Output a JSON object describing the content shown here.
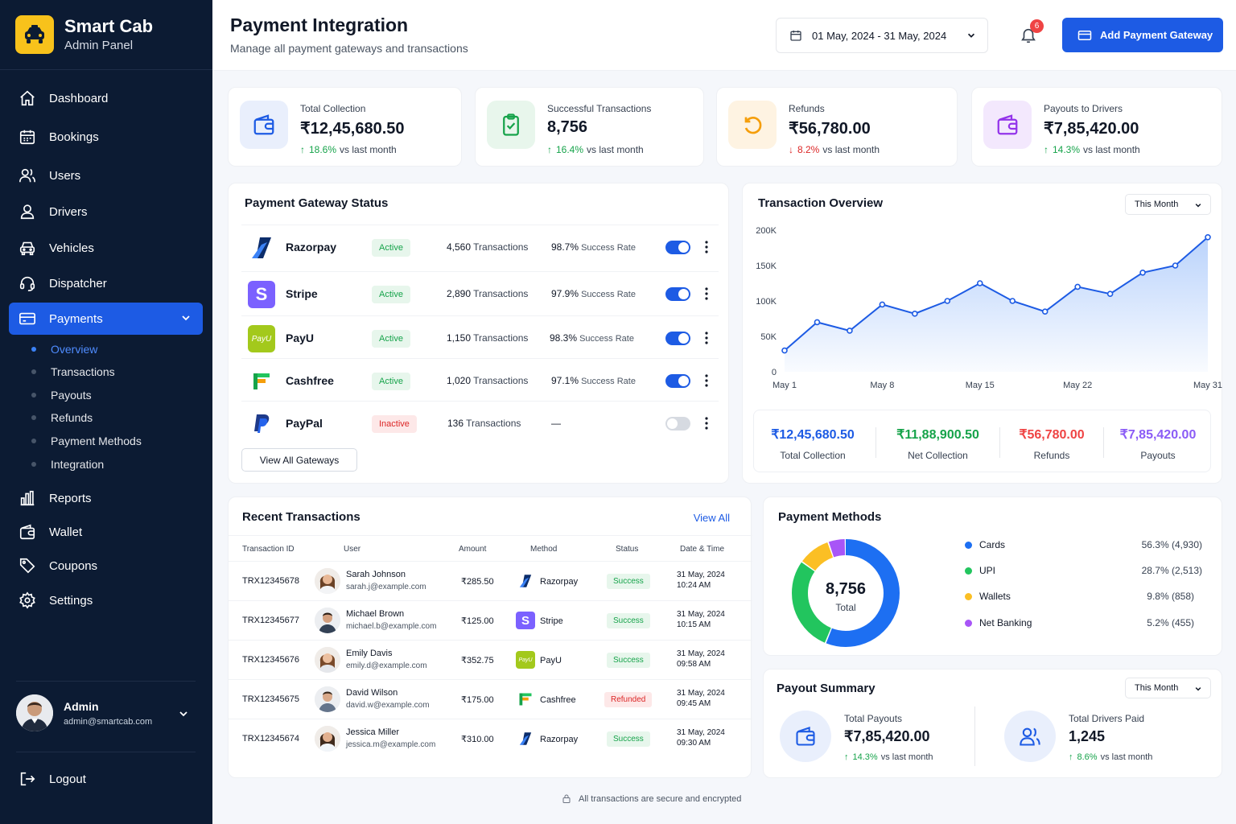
{
  "brand": {
    "title": "Smart Cab",
    "subtitle": "Admin Panel"
  },
  "nav": {
    "items": [
      {
        "label": "Dashboard",
        "icon": "home-icon"
      },
      {
        "label": "Bookings",
        "icon": "calendar-icon"
      },
      {
        "label": "Users",
        "icon": "users-icon"
      },
      {
        "label": "Drivers",
        "icon": "user-icon"
      },
      {
        "label": "Vehicles",
        "icon": "car-icon"
      },
      {
        "label": "Dispatcher",
        "icon": "headset-icon"
      },
      {
        "label": "Payments",
        "icon": "credit-card-icon",
        "active": true
      },
      {
        "label": "Reports",
        "icon": "bar-chart-icon"
      },
      {
        "label": "Wallet",
        "icon": "wallet-icon"
      },
      {
        "label": "Coupons",
        "icon": "tag-icon"
      },
      {
        "label": "Settings",
        "icon": "gear-icon"
      }
    ],
    "payments_sub": [
      "Overview",
      "Transactions",
      "Payouts",
      "Refunds",
      "Payment Methods",
      "Integration"
    ],
    "active_sub": "Overview"
  },
  "admin": {
    "name": "Admin",
    "email": "admin@smartcab.com"
  },
  "logout_label": "Logout",
  "header": {
    "title": "Payment Integration",
    "subtitle": "Manage all payment gateways and transactions",
    "date_range": "01 May, 2024 - 31 May, 2024",
    "notification_count": "6",
    "add_button": "Add Payment Gateway"
  },
  "stats": [
    {
      "label": "Total Collection",
      "value": "₹12,45,680.50",
      "change": "18.6%",
      "direction": "up",
      "suffix": "vs last month",
      "icon": "wallet-icon",
      "color": "#1d5be4"
    },
    {
      "label": "Successful Transactions",
      "value": "8,756",
      "change": "16.4%",
      "direction": "up",
      "suffix": "vs last month",
      "icon": "clipboard-check-icon",
      "color": "#16a34a"
    },
    {
      "label": "Refunds",
      "value": "₹56,780.00",
      "change": "8.2%",
      "direction": "down",
      "suffix": "vs last month",
      "icon": "refresh-icon",
      "color": "#f59e0b"
    },
    {
      "label": "Payouts to Drivers",
      "value": "₹7,85,420.00",
      "change": "14.3%",
      "direction": "up",
      "suffix": "vs last month",
      "icon": "wallet-icon",
      "color": "#9333ea"
    }
  ],
  "gateway_status": {
    "title": "Payment Gateway Status",
    "gateways": [
      {
        "name": "Razorpay",
        "status": "Active",
        "count": "4,560",
        "tx_label": "Transactions",
        "rate": "98.7%",
        "rate_label": "Success Rate",
        "enabled": true
      },
      {
        "name": "Stripe",
        "status": "Active",
        "count": "2,890",
        "tx_label": "Transactions",
        "rate": "97.9%",
        "rate_label": "Success Rate",
        "enabled": true
      },
      {
        "name": "PayU",
        "status": "Active",
        "count": "1,150",
        "tx_label": "Transactions",
        "rate": "98.3%",
        "rate_label": "Success Rate",
        "enabled": true
      },
      {
        "name": "Cashfree",
        "status": "Active",
        "count": "1,020",
        "tx_label": "Transactions",
        "rate": "97.1%",
        "rate_label": "Success Rate",
        "enabled": true
      },
      {
        "name": "PayPal",
        "status": "Inactive",
        "count": "136",
        "tx_label": "Transactions",
        "rate": "—",
        "rate_label": "",
        "enabled": false
      }
    ],
    "view_all": "View All Gateways"
  },
  "transaction_overview": {
    "title": "Transaction Overview",
    "period": "This Month",
    "summary": [
      {
        "value": "₹12,45,680.50",
        "label": "Total Collection",
        "color": "#1d5be4"
      },
      {
        "value": "₹11,88,900.50",
        "label": "Net Collection",
        "color": "#16a34a"
      },
      {
        "value": "₹56,780.00",
        "label": "Refunds",
        "color": "#ef4444"
      },
      {
        "value": "₹7,85,420.00",
        "label": "Payouts",
        "color": "#8b5cf6"
      }
    ]
  },
  "chart_data": {
    "type": "area",
    "x": [
      "May 1",
      "May 4",
      "May 6",
      "May 8",
      "May 10",
      "May 12",
      "May 15",
      "May 17",
      "May 19",
      "May 22",
      "May 24",
      "May 26",
      "May 29",
      "May 31"
    ],
    "values": [
      30000,
      70000,
      58000,
      95000,
      82000,
      100000,
      125000,
      100000,
      85000,
      120000,
      110000,
      140000,
      150000,
      190000
    ],
    "x_tick_labels": [
      "May 1",
      "May 8",
      "May 15",
      "May 22",
      "May 31"
    ],
    "y_tick_labels": [
      "0",
      "50K",
      "100K",
      "150K",
      "200K"
    ],
    "ylim": [
      0,
      200000
    ],
    "color": "#1d5be4"
  },
  "recent_transactions": {
    "title": "Recent Transactions",
    "view_all": "View All",
    "columns": [
      "Transaction ID",
      "User",
      "Amount",
      "Method",
      "Status",
      "Date & Time"
    ],
    "rows": [
      {
        "id": "TRX12345678",
        "user": "Sarah Johnson",
        "email": "sarah.j@example.com",
        "amount": "₹285.50",
        "method": "Razorpay",
        "status": "Success",
        "date": "31 May, 2024",
        "time": "10:24 AM",
        "gender": "f"
      },
      {
        "id": "TRX12345677",
        "user": "Michael Brown",
        "email": "michael.b@example.com",
        "amount": "₹125.00",
        "method": "Stripe",
        "status": "Success",
        "date": "31 May, 2024",
        "time": "10:15 AM",
        "gender": "m"
      },
      {
        "id": "TRX12345676",
        "user": "Emily Davis",
        "email": "emily.d@example.com",
        "amount": "₹352.75",
        "method": "PayU",
        "status": "Success",
        "date": "31 May, 2024",
        "time": "09:58 AM",
        "gender": "f"
      },
      {
        "id": "TRX12345675",
        "user": "David Wilson",
        "email": "david.w@example.com",
        "amount": "₹175.00",
        "method": "Cashfree",
        "status": "Refunded",
        "date": "31 May, 2024",
        "time": "09:45 AM",
        "gender": "m"
      },
      {
        "id": "TRX12345674",
        "user": "Jessica Miller",
        "email": "jessica.m@example.com",
        "amount": "₹310.00",
        "method": "Razorpay",
        "status": "Success",
        "date": "31 May, 2024",
        "time": "09:30 AM",
        "gender": "f"
      }
    ]
  },
  "payment_methods": {
    "title": "Payment Methods",
    "total_value": "8,756",
    "total_label": "Total",
    "methods": [
      {
        "name": "Cards",
        "value": "56.3% (4,930)",
        "share": 56.3,
        "color": "#1d6ff2"
      },
      {
        "name": "UPI",
        "value": "28.7% (2,513)",
        "share": 28.7,
        "color": "#22c55e"
      },
      {
        "name": "Wallets",
        "value": "9.8% (858)",
        "share": 9.8,
        "color": "#fbbf24"
      },
      {
        "name": "Net Banking",
        "value": "5.2% (455)",
        "share": 5.2,
        "color": "#a855f7"
      }
    ]
  },
  "payout_summary": {
    "title": "Payout Summary",
    "period": "This Month",
    "total_payouts_label": "Total Payouts",
    "total_payouts": "₹7,85,420.00",
    "total_payouts_change": "14.3%",
    "drivers_label": "Total Drivers Paid",
    "drivers": "1,245",
    "drivers_change": "8.6%",
    "suffix": "vs last month"
  },
  "footer_note": "All transactions are secure and encrypted"
}
